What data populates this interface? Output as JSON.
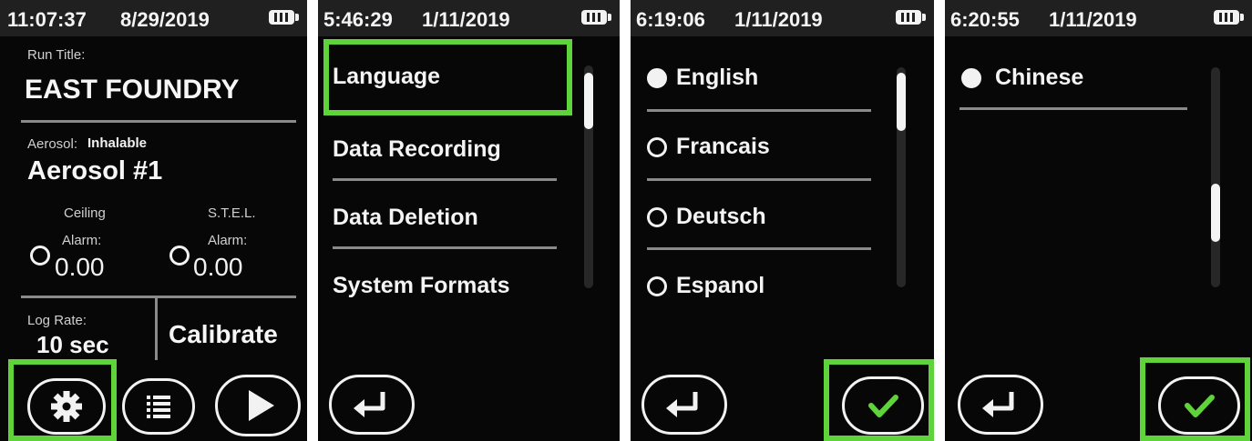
{
  "colors": {
    "highlight": "#5fd33a",
    "screen_bg": "#070707",
    "status_bg": "#202020",
    "check": "#5fd33a"
  },
  "screen1": {
    "status": {
      "time": "11:07:37",
      "date": "8/29/2019"
    },
    "run_title_label": "Run Title:",
    "run_title": "EAST FOUNDRY",
    "aerosol_label": "Aerosol:",
    "aerosol_type": "Inhalable",
    "aerosol_name": "Aerosol #1",
    "ceiling": {
      "label": "Ceiling",
      "alarm_label": "Alarm:",
      "value": "0.00"
    },
    "stel": {
      "label": "S.T.E.L.",
      "alarm_label": "Alarm:",
      "value": "0.00"
    },
    "log_rate_label": "Log Rate:",
    "log_rate_value": "10 sec",
    "calibrate_label": "Calibrate",
    "buttons": {
      "settings_icon": "gear-icon",
      "list_icon": "list-icon",
      "play_icon": "play-icon"
    }
  },
  "screen2": {
    "status": {
      "time": "5:46:29",
      "date": "1/11/2019"
    },
    "menu": [
      "Language",
      "Data Recording",
      "Data Deletion",
      "System Formats"
    ],
    "back_icon": "return-arrow-icon"
  },
  "screen3": {
    "status": {
      "time": "6:19:06",
      "date": "1/11/2019"
    },
    "languages": [
      {
        "label": "English",
        "selected": true
      },
      {
        "label": "Francais",
        "selected": false
      },
      {
        "label": "Deutsch",
        "selected": false
      },
      {
        "label": "Espanol",
        "selected": false
      }
    ],
    "back_icon": "return-arrow-icon",
    "confirm_icon": "checkmark-icon"
  },
  "screen4": {
    "status": {
      "time": "6:20:55",
      "date": "1/11/2019"
    },
    "languages": [
      {
        "label": "Chinese",
        "selected": true
      }
    ],
    "back_icon": "return-arrow-icon",
    "confirm_icon": "checkmark-icon"
  }
}
